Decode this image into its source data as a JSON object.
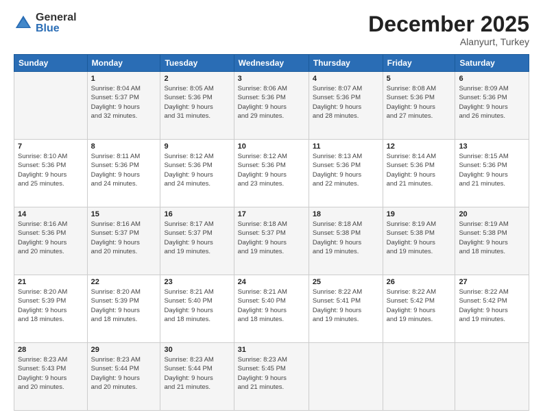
{
  "header": {
    "logo_general": "General",
    "logo_blue": "Blue",
    "month_title": "December 2025",
    "location": "Alanyurt, Turkey"
  },
  "days_of_week": [
    "Sunday",
    "Monday",
    "Tuesday",
    "Wednesday",
    "Thursday",
    "Friday",
    "Saturday"
  ],
  "weeks": [
    [
      {
        "num": "",
        "info": ""
      },
      {
        "num": "1",
        "info": "Sunrise: 8:04 AM\nSunset: 5:37 PM\nDaylight: 9 hours\nand 32 minutes."
      },
      {
        "num": "2",
        "info": "Sunrise: 8:05 AM\nSunset: 5:36 PM\nDaylight: 9 hours\nand 31 minutes."
      },
      {
        "num": "3",
        "info": "Sunrise: 8:06 AM\nSunset: 5:36 PM\nDaylight: 9 hours\nand 29 minutes."
      },
      {
        "num": "4",
        "info": "Sunrise: 8:07 AM\nSunset: 5:36 PM\nDaylight: 9 hours\nand 28 minutes."
      },
      {
        "num": "5",
        "info": "Sunrise: 8:08 AM\nSunset: 5:36 PM\nDaylight: 9 hours\nand 27 minutes."
      },
      {
        "num": "6",
        "info": "Sunrise: 8:09 AM\nSunset: 5:36 PM\nDaylight: 9 hours\nand 26 minutes."
      }
    ],
    [
      {
        "num": "7",
        "info": "Sunrise: 8:10 AM\nSunset: 5:36 PM\nDaylight: 9 hours\nand 25 minutes."
      },
      {
        "num": "8",
        "info": "Sunrise: 8:11 AM\nSunset: 5:36 PM\nDaylight: 9 hours\nand 24 minutes."
      },
      {
        "num": "9",
        "info": "Sunrise: 8:12 AM\nSunset: 5:36 PM\nDaylight: 9 hours\nand 24 minutes."
      },
      {
        "num": "10",
        "info": "Sunrise: 8:12 AM\nSunset: 5:36 PM\nDaylight: 9 hours\nand 23 minutes."
      },
      {
        "num": "11",
        "info": "Sunrise: 8:13 AM\nSunset: 5:36 PM\nDaylight: 9 hours\nand 22 minutes."
      },
      {
        "num": "12",
        "info": "Sunrise: 8:14 AM\nSunset: 5:36 PM\nDaylight: 9 hours\nand 21 minutes."
      },
      {
        "num": "13",
        "info": "Sunrise: 8:15 AM\nSunset: 5:36 PM\nDaylight: 9 hours\nand 21 minutes."
      }
    ],
    [
      {
        "num": "14",
        "info": "Sunrise: 8:16 AM\nSunset: 5:36 PM\nDaylight: 9 hours\nand 20 minutes."
      },
      {
        "num": "15",
        "info": "Sunrise: 8:16 AM\nSunset: 5:37 PM\nDaylight: 9 hours\nand 20 minutes."
      },
      {
        "num": "16",
        "info": "Sunrise: 8:17 AM\nSunset: 5:37 PM\nDaylight: 9 hours\nand 19 minutes."
      },
      {
        "num": "17",
        "info": "Sunrise: 8:18 AM\nSunset: 5:37 PM\nDaylight: 9 hours\nand 19 minutes."
      },
      {
        "num": "18",
        "info": "Sunrise: 8:18 AM\nSunset: 5:38 PM\nDaylight: 9 hours\nand 19 minutes."
      },
      {
        "num": "19",
        "info": "Sunrise: 8:19 AM\nSunset: 5:38 PM\nDaylight: 9 hours\nand 19 minutes."
      },
      {
        "num": "20",
        "info": "Sunrise: 8:19 AM\nSunset: 5:38 PM\nDaylight: 9 hours\nand 18 minutes."
      }
    ],
    [
      {
        "num": "21",
        "info": "Sunrise: 8:20 AM\nSunset: 5:39 PM\nDaylight: 9 hours\nand 18 minutes."
      },
      {
        "num": "22",
        "info": "Sunrise: 8:20 AM\nSunset: 5:39 PM\nDaylight: 9 hours\nand 18 minutes."
      },
      {
        "num": "23",
        "info": "Sunrise: 8:21 AM\nSunset: 5:40 PM\nDaylight: 9 hours\nand 18 minutes."
      },
      {
        "num": "24",
        "info": "Sunrise: 8:21 AM\nSunset: 5:40 PM\nDaylight: 9 hours\nand 18 minutes."
      },
      {
        "num": "25",
        "info": "Sunrise: 8:22 AM\nSunset: 5:41 PM\nDaylight: 9 hours\nand 19 minutes."
      },
      {
        "num": "26",
        "info": "Sunrise: 8:22 AM\nSunset: 5:42 PM\nDaylight: 9 hours\nand 19 minutes."
      },
      {
        "num": "27",
        "info": "Sunrise: 8:22 AM\nSunset: 5:42 PM\nDaylight: 9 hours\nand 19 minutes."
      }
    ],
    [
      {
        "num": "28",
        "info": "Sunrise: 8:23 AM\nSunset: 5:43 PM\nDaylight: 9 hours\nand 20 minutes."
      },
      {
        "num": "29",
        "info": "Sunrise: 8:23 AM\nSunset: 5:44 PM\nDaylight: 9 hours\nand 20 minutes."
      },
      {
        "num": "30",
        "info": "Sunrise: 8:23 AM\nSunset: 5:44 PM\nDaylight: 9 hours\nand 21 minutes."
      },
      {
        "num": "31",
        "info": "Sunrise: 8:23 AM\nSunset: 5:45 PM\nDaylight: 9 hours\nand 21 minutes."
      },
      {
        "num": "",
        "info": ""
      },
      {
        "num": "",
        "info": ""
      },
      {
        "num": "",
        "info": ""
      }
    ]
  ]
}
